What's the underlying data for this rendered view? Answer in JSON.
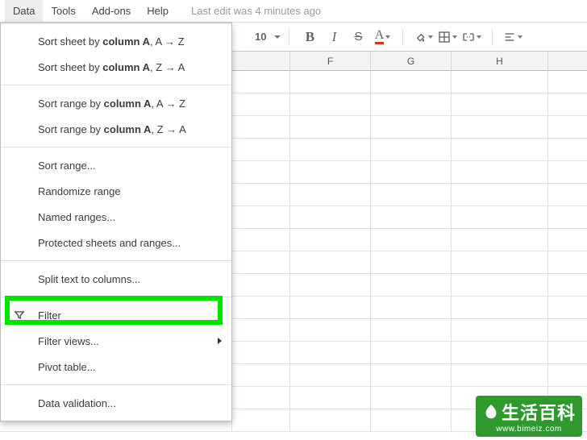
{
  "menubar": {
    "data": "Data",
    "tools": "Tools",
    "addons": "Add-ons",
    "help": "Help",
    "status": "Last edit was 4 minutes ago"
  },
  "toolbar": {
    "font_size": "10",
    "bold": "B",
    "italic": "I",
    "strike": "S",
    "text_color": "A"
  },
  "columns": {
    "f": "F",
    "g": "G",
    "h": "H"
  },
  "dropdown": {
    "sort_sheet_az_pre": "Sort sheet by ",
    "sort_sheet_az_col": "column A",
    "sort_sheet_az_suf": ", A → Z",
    "sort_sheet_za_pre": "Sort sheet by ",
    "sort_sheet_za_col": "column A",
    "sort_sheet_za_suf": ", Z → A",
    "sort_range_az_pre": "Sort range by ",
    "sort_range_az_col": "column A",
    "sort_range_az_suf": ", A → Z",
    "sort_range_za_pre": "Sort range by ",
    "sort_range_za_col": "column A",
    "sort_range_za_suf": ", Z → A",
    "sort_range": "Sort range...",
    "randomize": "Randomize range",
    "named_ranges": "Named ranges...",
    "protected": "Protected sheets and ranges...",
    "split_text": "Split text to columns...",
    "filter": "Filter",
    "filter_views": "Filter views...",
    "pivot": "Pivot table...",
    "data_validation": "Data validation..."
  },
  "watermark": {
    "chars": "生活百科",
    "url": "www.bimeiz.com"
  }
}
